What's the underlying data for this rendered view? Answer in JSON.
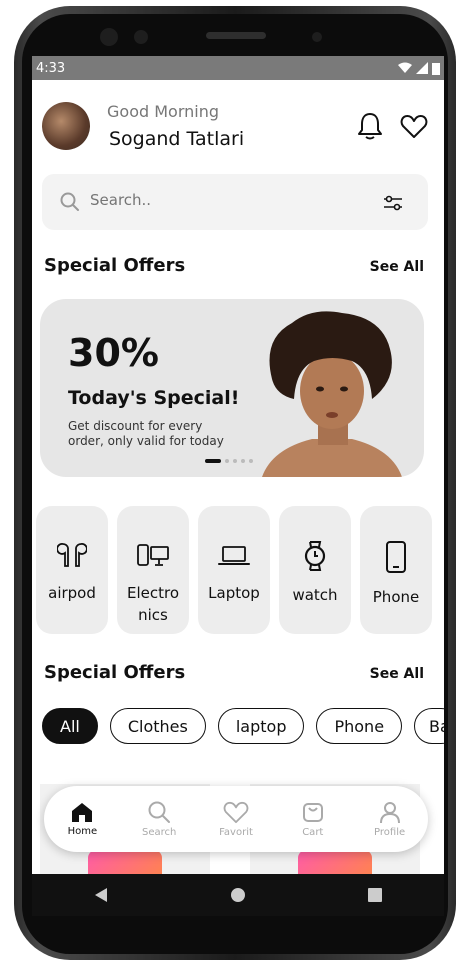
{
  "status": {
    "time": "4:33"
  },
  "header": {
    "greeting": "Good Morning",
    "name": "Sogand Tatlari",
    "icons": [
      "bell-icon",
      "heart-icon"
    ]
  },
  "search": {
    "placeholder": "Search..",
    "icon": "search-icon",
    "filter_icon": "filter-sliders-icon"
  },
  "offers1": {
    "title": "Special Offers",
    "see_all": "See All"
  },
  "banner": {
    "percent": "30%",
    "title": "Today's Special!",
    "description": "Get discount for every order, only valid for today",
    "slide_index": 1,
    "slide_count": 5
  },
  "categories": [
    {
      "label": "airpod",
      "icon": "airpods-icon"
    },
    {
      "label": "Electro nics",
      "icon": "devices-icon"
    },
    {
      "label": "Laptop",
      "icon": "laptop-icon"
    },
    {
      "label": "watch",
      "icon": "watch-icon"
    },
    {
      "label": "Phone",
      "icon": "phone-icon"
    }
  ],
  "offers2": {
    "title": "Special Offers",
    "see_all": "See All"
  },
  "chips": [
    {
      "label": "All",
      "active": true
    },
    {
      "label": "Clothes",
      "active": false
    },
    {
      "label": "laptop",
      "active": false
    },
    {
      "label": "Phone",
      "active": false
    },
    {
      "label": "Ba",
      "active": false
    }
  ],
  "nav": [
    {
      "label": "Home",
      "icon": "home-icon",
      "active": true
    },
    {
      "label": "Search",
      "icon": "search-icon",
      "active": false
    },
    {
      "label": "Favorit",
      "icon": "heart-icon",
      "active": false
    },
    {
      "label": "Cart",
      "icon": "cart-icon",
      "active": false
    },
    {
      "label": "Profile",
      "icon": "profile-icon",
      "active": false
    }
  ],
  "colors": {
    "accent": "#111111",
    "card": "#ededed",
    "banner": "#e6e6e6",
    "statusbar": "#7a7a7a"
  }
}
